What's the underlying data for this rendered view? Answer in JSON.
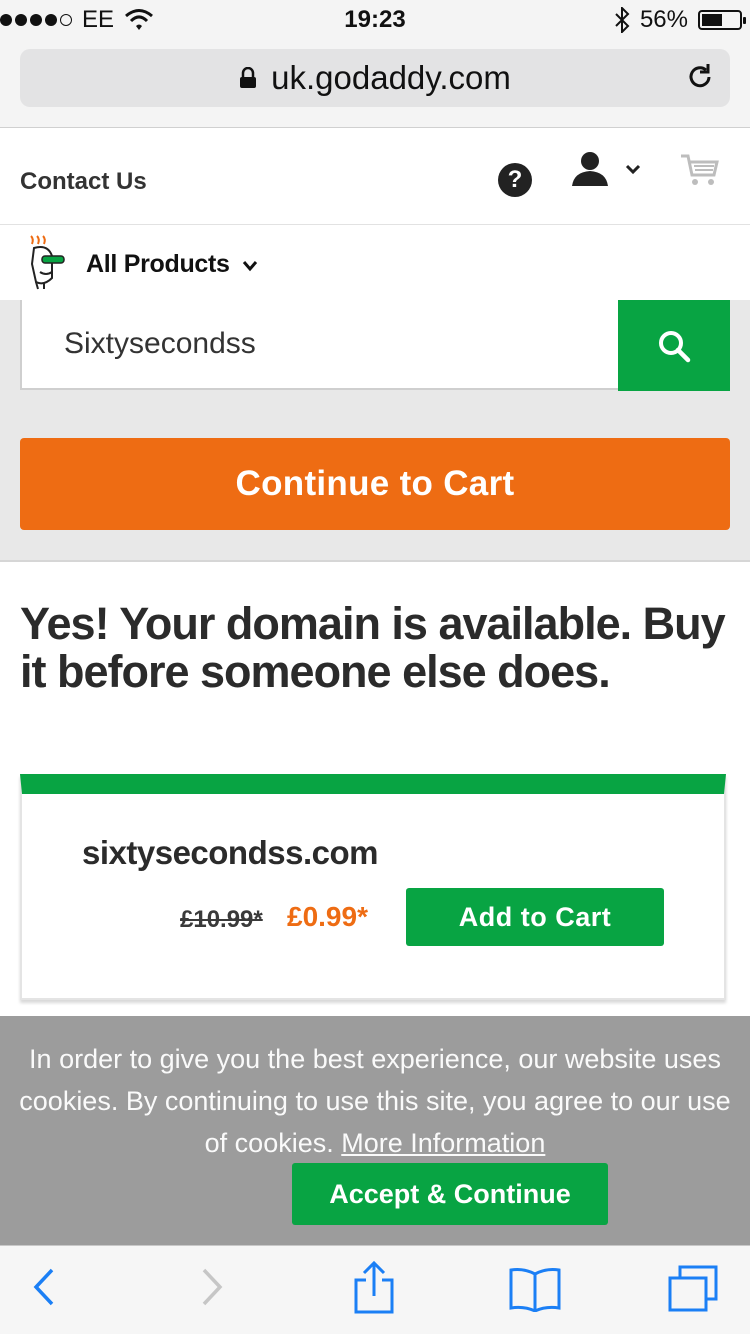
{
  "status_bar": {
    "carrier": "EE",
    "time": "19:23",
    "battery": "56%",
    "battery_level": 0.56
  },
  "browser": {
    "url": "uk.godaddy.com"
  },
  "header": {
    "contact_label": "Contact Us",
    "help_label": "?"
  },
  "nav": {
    "all_products_label": "All Products"
  },
  "search": {
    "value": "Sixtysecondss"
  },
  "continue_cart_label": "Continue to Cart",
  "result": {
    "headline": "Yes! Your domain is available. Buy it before someone else does.",
    "domain": "sixtysecondss.com",
    "old_price": "£10.99*",
    "new_price": "£0.99*",
    "add_to_cart_label": "Add to Cart"
  },
  "cookie_banner": {
    "text": "In order to give you the best experience, our website uses cookies. By continuing to use this site, you agree to our use of cookies.",
    "link_label": "More Information",
    "accept_label": "Accept & Continue"
  },
  "colors": {
    "accent_green": "#08a443",
    "accent_orange": "#ee6c13"
  },
  "icons": [
    "lock-icon",
    "reload-icon",
    "help-icon",
    "user-icon",
    "chevron-down-icon",
    "cart-icon",
    "mascot-logo",
    "search-icon",
    "back-icon",
    "forward-icon",
    "share-icon",
    "bookmarks-icon",
    "tabs-icon"
  ]
}
